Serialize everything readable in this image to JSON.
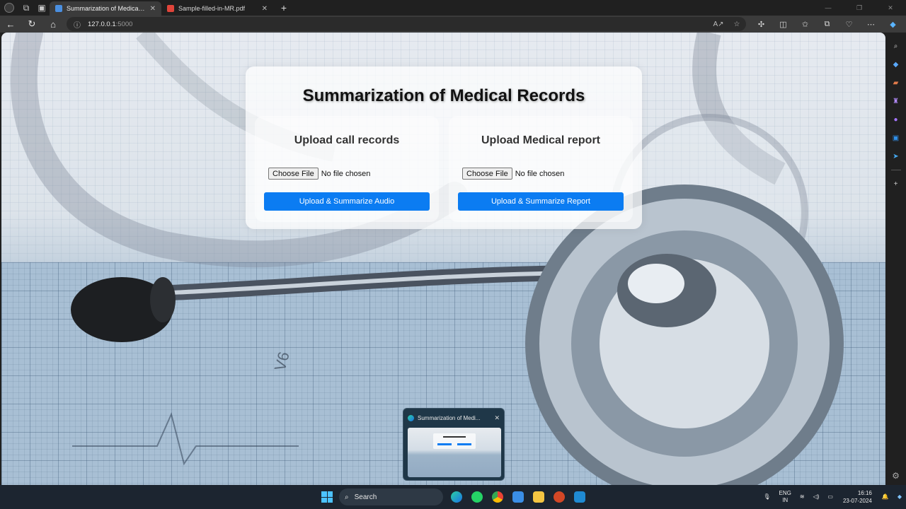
{
  "browser": {
    "tabs": [
      {
        "title": "Summarization of Medical Records",
        "favicon_color": "#4a8fe0",
        "active": true
      },
      {
        "title": "Sample-filled-in-MR.pdf",
        "favicon_color": "#e0443a",
        "active": false
      }
    ],
    "new_tab_label": "+",
    "address": {
      "host": "127.0.0.1",
      "port": ":5000"
    }
  },
  "app": {
    "title": "Summarization of Medical Records",
    "call_panel": {
      "heading": "Upload call records",
      "choose_label": "Choose File",
      "file_status": "No file chosen",
      "submit_label": "Upload & Summarize Audio"
    },
    "report_panel": {
      "heading": "Upload Medical report",
      "choose_label": "Choose File",
      "file_status": "No file chosen",
      "submit_label": "Upload & Summarize Report"
    },
    "accent_color": "#0b7cf2"
  },
  "taskbar": {
    "preview_title": "Summarization of Medi...",
    "search_placeholder": "Search",
    "language": {
      "line1": "ENG",
      "line2": "IN"
    },
    "time": "16:16",
    "date": "23-07-2024"
  }
}
